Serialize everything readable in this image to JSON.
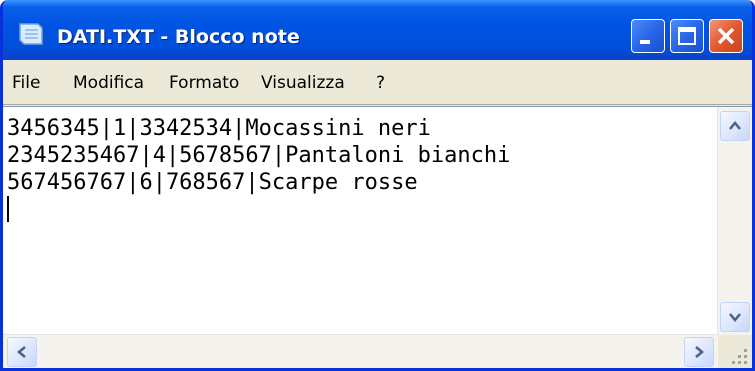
{
  "window": {
    "title": "DATI.TXT - Blocco note",
    "controls": [
      "minimize",
      "maximize",
      "close"
    ]
  },
  "menu": {
    "items": [
      "File",
      "Modifica",
      "Formato",
      "Visualizza",
      "?"
    ]
  },
  "document": {
    "lines": [
      "3456345|1|3342534|Mocassini neri",
      "2345235467|4|5678567|Pantaloni bianchi",
      "567456767|6|768567|Scarpe rosse"
    ]
  },
  "colors": {
    "titlebar": "#0054e3",
    "frame": "#0831d9",
    "close_button": "#e2592f",
    "menubar": "#ece9d8",
    "editor_bg": "#ffffff"
  },
  "icons": [
    "notepad-icon",
    "minimize-icon",
    "maximize-icon",
    "close-icon",
    "scroll-up-icon",
    "scroll-down-icon",
    "scroll-left-icon",
    "scroll-right-icon",
    "resize-grip-icon"
  ]
}
